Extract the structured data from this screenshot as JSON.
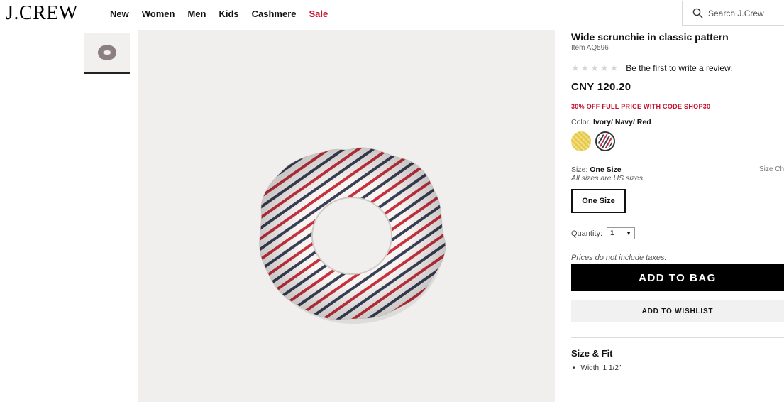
{
  "header": {
    "logo": "J.CREW",
    "nav": [
      "New",
      "Women",
      "Men",
      "Kids",
      "Cashmere",
      "Sale"
    ],
    "search_placeholder": "Search J.Crew"
  },
  "product": {
    "title": "Wide scrunchie in classic pattern",
    "item_number": "Item AQ596",
    "review_link": "Be the first to write a review.",
    "rating": 0,
    "price": "CNY 120.20",
    "promo": "30% OFF FULL PRICE WITH CODE SHOP30",
    "color_label": "Color:",
    "color_value": "Ivory/ Navy/ Red",
    "size_label": "Size:",
    "size_value": "One Size",
    "size_chart": "Size Ch",
    "size_note": "All sizes are US sizes.",
    "size_option": "One Size",
    "quantity_label": "Quantity:",
    "quantity_value": "1",
    "tax_note": "Prices do not include taxes.",
    "add_to_bag": "ADD TO BAG",
    "add_to_wishlist": "ADD TO WISHLIST",
    "size_fit_title": "Size & Fit",
    "size_fit_items": [
      "Width: 1 1/2\""
    ]
  },
  "colors": {
    "accent_red": "#c8102e",
    "stripe_red": "#c6303f",
    "stripe_navy": "#394056",
    "swatch_yellow": "#e6c84a"
  }
}
